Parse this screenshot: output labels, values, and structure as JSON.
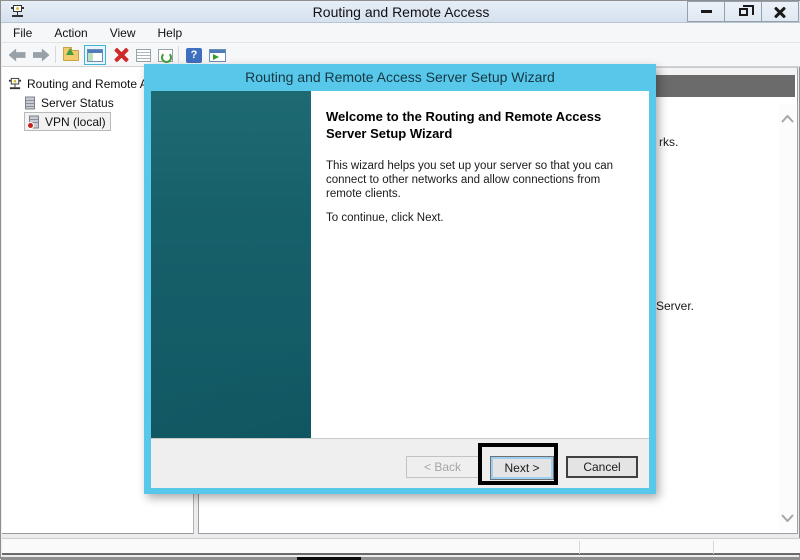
{
  "window": {
    "title": "Routing and Remote Access"
  },
  "menu": {
    "items": [
      "File",
      "Action",
      "View",
      "Help"
    ]
  },
  "toolbar": {
    "icons": [
      "back",
      "forward",
      "up-one-level",
      "show-console-tree",
      "delete",
      "properties",
      "refresh",
      "help",
      "taskpad"
    ],
    "glyphs": {
      "help": "?"
    }
  },
  "tree": {
    "items": [
      {
        "label": "Routing and Remote A"
      },
      {
        "label": "Server Status"
      },
      {
        "label": "VPN (local)"
      }
    ]
  },
  "content": {
    "fragment_top": "rks.",
    "fragment_bottom": "Server."
  },
  "wizard": {
    "title": "Routing and Remote Access Server Setup Wizard",
    "heading_lines": [
      "Welcome to the Routing and Remote Access",
      "Server Setup Wizard"
    ],
    "body_lines": [
      "This wizard helps you set up your server so that you can",
      "connect to other networks and allow connections from",
      "remote clients."
    ],
    "instruction": "To continue, click Next.",
    "buttons": {
      "back": "< Back",
      "next": "Next >",
      "cancel": "Cancel"
    }
  },
  "colors": {
    "accent_cyan": "#57c7ea",
    "teal_dark": "#115863",
    "band_gray": "#6b6b6b",
    "annotation_black": "#000000",
    "delete_red": "#cf2a27",
    "help_blue": "#3f6fbf"
  }
}
